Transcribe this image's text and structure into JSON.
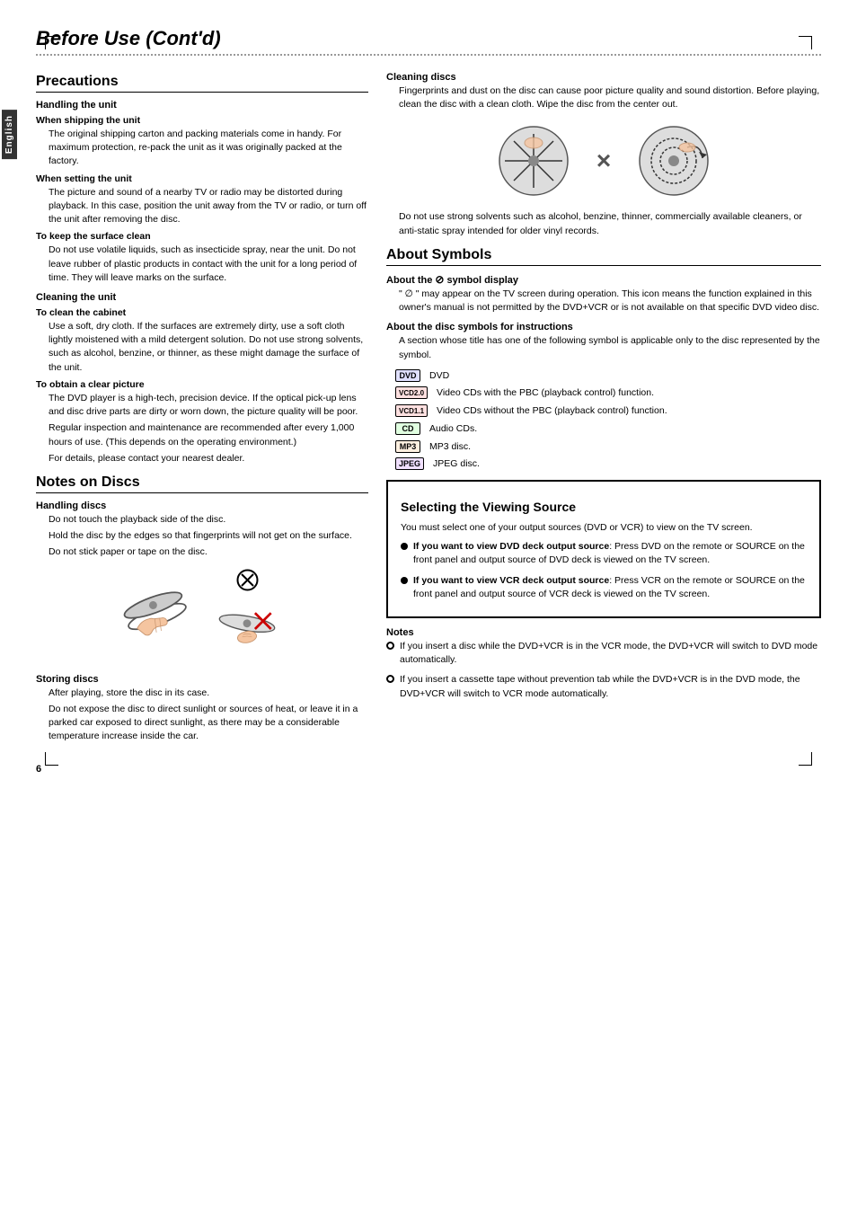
{
  "page": {
    "title": "Before Use (Cont'd)",
    "page_number": "6",
    "english_tab": "English"
  },
  "precautions": {
    "title": "Precautions",
    "handling": {
      "title": "Handling the unit",
      "shipping": {
        "title": "When shipping the unit",
        "text": "The original shipping carton and packing materials come in handy. For maximum protection, re-pack the unit as it was originally packed at the factory."
      },
      "setting": {
        "title": "When setting the unit",
        "text": "The picture and sound of a nearby TV or radio may be distorted during playback. In this case, position the unit away from the TV or radio, or turn off the unit after removing the disc."
      },
      "surface": {
        "title": "To keep the surface clean",
        "text": "Do not use volatile liquids, such as insecticide spray, near the unit. Do not leave rubber of plastic products in contact with the unit for a long period of time. They will leave marks on the surface."
      }
    },
    "cleaning_unit": {
      "title": "Cleaning the unit",
      "cabinet": {
        "title": "To clean the cabinet",
        "text": "Use a soft, dry cloth. If the surfaces are extremely dirty, use a soft cloth lightly moistened with a mild detergent solution. Do not use strong solvents, such as alcohol, benzine, or thinner, as these might damage the surface of the unit."
      },
      "clear_picture": {
        "title": "To obtain a clear picture",
        "text1": "The DVD player is a high-tech, precision device. If the optical pick-up lens and disc drive parts are dirty or worn down, the picture quality will be poor.",
        "text2": "Regular inspection and maintenance are recommended after every 1,000 hours of use. (This depends on the operating environment.)",
        "text3": "For details, please contact your nearest dealer."
      }
    }
  },
  "notes_on_discs": {
    "title": "Notes on Discs",
    "handling": {
      "title": "Handling discs",
      "text1": "Do not touch the playback side of the disc.",
      "text2": "Hold the disc by the edges so that fingerprints will not get on the surface.",
      "text3": "Do not stick paper or tape on the disc."
    },
    "storing": {
      "title": "Storing discs",
      "text1": "After playing, store the disc in its case.",
      "text2": "Do not expose the disc to direct sunlight or sources of heat, or leave it in a parked car exposed to direct sunlight, as there may be a considerable temperature increase inside the car."
    }
  },
  "cleaning_discs": {
    "title": "Cleaning discs",
    "text1": "Fingerprints and dust on the disc can cause poor picture quality and sound distortion. Before playing, clean the disc with a clean cloth. Wipe the disc from the center out.",
    "text2": "Do not use strong solvents such as alcohol, benzine, thinner, commercially available cleaners, or anti-static spray intended for older vinyl records."
  },
  "about_symbols": {
    "title": "About Symbols",
    "symbol_display": {
      "title": "About the ∅ symbol display",
      "text": "\" ∅ \" may appear on the TV screen during operation. This icon means the function explained in this owner's manual is not permitted by the DVD+VCR or is not available on that specific DVD video disc."
    },
    "disc_symbols": {
      "title": "About the disc symbols for instructions",
      "text": "A section whose title has one of the following symbol is applicable only to the disc represented by the symbol.",
      "symbols": [
        {
          "badge": "DVD",
          "badge_class": "dvd-badge",
          "label": "DVD"
        },
        {
          "badge": "VCD2.0",
          "badge_class": "vcd2-badge",
          "label": "Video CDs with the PBC (playback control) function."
        },
        {
          "badge": "VCD1.1",
          "badge_class": "vcd1-badge",
          "label": "Video CDs without the PBC (playback control) function."
        },
        {
          "badge": "CD",
          "badge_class": "cd-badge",
          "label": "Audio CDs."
        },
        {
          "badge": "MP3",
          "badge_class": "mp3-badge",
          "label": "MP3 disc."
        },
        {
          "badge": "JPEG",
          "badge_class": "jpeg-badge",
          "label": "JPEG disc."
        }
      ]
    }
  },
  "selecting_viewing": {
    "title": "Selecting the Viewing Source",
    "intro": "You must select one of your output sources (DVD or VCR) to view on the TV screen.",
    "dvd_source": {
      "label": "If you want to view DVD deck output source",
      "text": "Press DVD on the remote or SOURCE on the front panel and output source of DVD deck is viewed on the TV screen."
    },
    "vcr_source": {
      "label": "If you want to view VCR deck output source",
      "text": "Press VCR on the remote or SOURCE on the front panel and output source of VCR deck is viewed on the TV screen."
    },
    "notes_title": "Notes",
    "notes": [
      "If you insert a disc while the DVD+VCR is in the VCR mode, the DVD+VCR will switch to DVD mode automatically.",
      "If you insert a cassette tape without prevention tab while the DVD+VCR is in the DVD mode, the DVD+VCR will switch to VCR mode automatically."
    ]
  }
}
